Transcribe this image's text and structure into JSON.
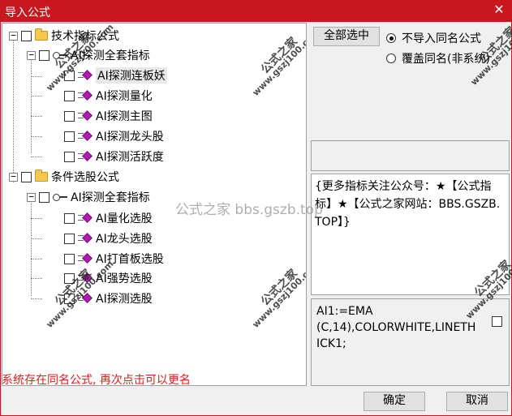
{
  "window": {
    "title": "导入公式",
    "close_glyph": "✕"
  },
  "tree": {
    "groups": [
      {
        "label": "技术指标公式",
        "children": [
          {
            "label": "AI探测全套指标",
            "items": [
              "AI探测连板妖",
              "AI探测量化",
              "AI探测主图",
              "AI探测龙头股",
              "AI探测活跃度"
            ]
          }
        ]
      },
      {
        "label": "条件选股公式",
        "children": [
          {
            "label": "AI探测全套指标",
            "items": [
              "AI量化选股",
              "AI龙头选股",
              "AI打首板选股",
              "AI强势选股",
              "AI探测选股"
            ]
          }
        ]
      }
    ]
  },
  "buttons": {
    "select_all": "全部选中",
    "ok": "确定",
    "cancel": "取消"
  },
  "options": {
    "no_import_same": "不导入同名公式",
    "overwrite_same": "覆盖同名(非系统)"
  },
  "description_text": "{更多指标关注公众号：★【公式指标】★【公式之家网站：BBS.GSZB.TOP】}",
  "code_text": "AI1:=EMA\n(C,14),COLORWHITE,LINETHICK1;",
  "status_message": "系统存在同名公式, 再次点击可以更名",
  "watermark": {
    "center_text": "公式之家 bbs.gszb.top",
    "stamp_main": "公式之家",
    "stamp_url": "www.gszj100.com"
  }
}
